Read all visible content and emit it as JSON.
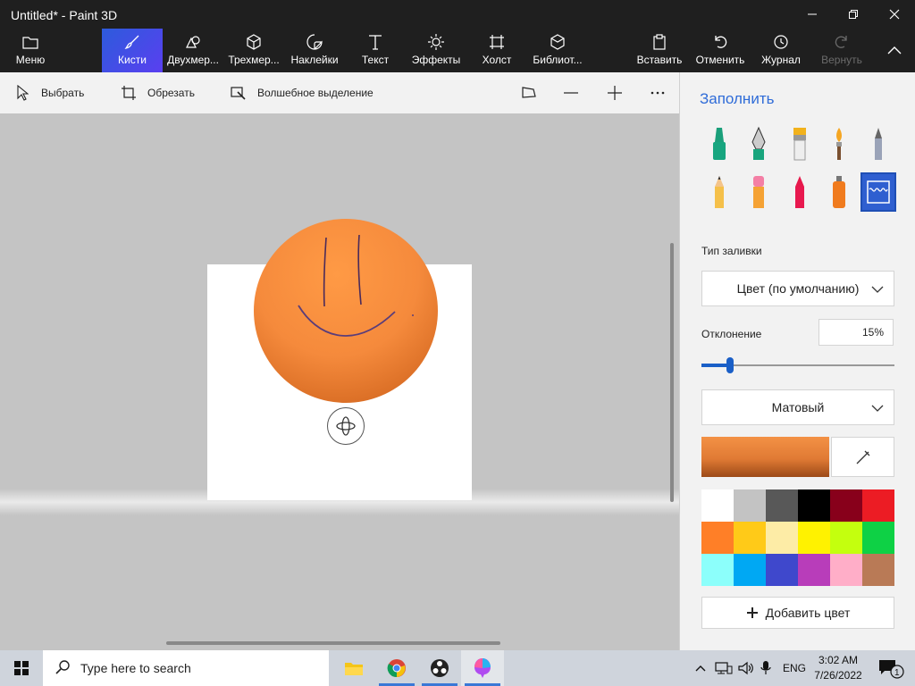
{
  "window": {
    "title": "Untitled* - Paint 3D",
    "controls": [
      "minimize",
      "maximize",
      "close"
    ]
  },
  "ribbon": {
    "items": [
      {
        "label": "Меню",
        "icon": "folder-icon"
      },
      {
        "label": "Кисти",
        "icon": "brush-icon",
        "active": true
      },
      {
        "label": "Двухмер...",
        "icon": "2d-shapes-icon"
      },
      {
        "label": "Трехмер...",
        "icon": "3d-shapes-icon"
      },
      {
        "label": "Наклейки",
        "icon": "stickers-icon"
      },
      {
        "label": "Текст",
        "icon": "text-icon"
      },
      {
        "label": "Эффекты",
        "icon": "effects-icon"
      },
      {
        "label": "Холст",
        "icon": "canvas-icon"
      },
      {
        "label": "Библиот...",
        "icon": "library-icon"
      }
    ],
    "right_items": [
      {
        "label": "Вставить",
        "icon": "paste-icon"
      },
      {
        "label": "Отменить",
        "icon": "undo-icon"
      },
      {
        "label": "Журнал",
        "icon": "history-icon"
      },
      {
        "label": "Вернуть",
        "icon": "redo-icon",
        "disabled": true
      }
    ]
  },
  "toolbar": {
    "select": "Выбрать",
    "crop": "Обрезать",
    "magic_select": "Волшебное выделение"
  },
  "panel": {
    "title": "Заполнить",
    "fill_type_label": "Тип заливки",
    "fill_type_value": "Цвет (по умолчанию)",
    "deviation_label": "Отклонение",
    "deviation_value": "15%",
    "deviation_percent": 15,
    "finish_value": "Матовый",
    "current_color": "#e07a34",
    "add_color": "Добавить цвет",
    "palette": [
      "#ffffff",
      "#c3c3c3",
      "#585858",
      "#000000",
      "#88001b",
      "#ec1c24",
      "#ff7f27",
      "#ffca18",
      "#fdeca6",
      "#fff200",
      "#c4ff0e",
      "#0ed145",
      "#8cfffb",
      "#00a8f3",
      "#3f48cc",
      "#b83dba",
      "#ffaec8",
      "#b97a56"
    ]
  },
  "taskbar": {
    "search_placeholder": "Type here to search",
    "language": "ENG",
    "time": "3:02 AM",
    "date": "7/26/2022",
    "notification_count": "1"
  }
}
